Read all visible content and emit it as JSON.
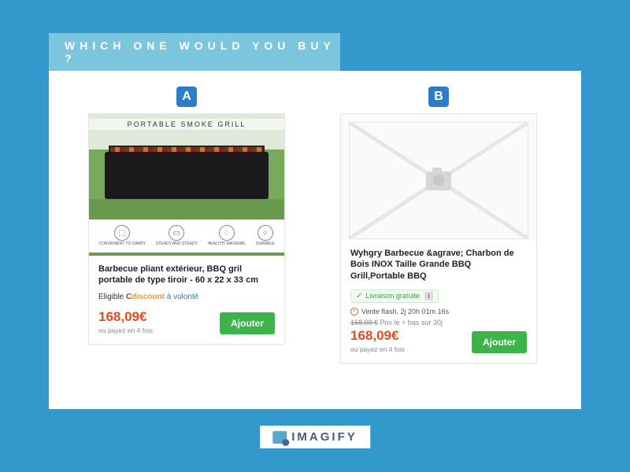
{
  "header": {
    "title": "WHICH ONE WOULD YOU BUY ?"
  },
  "badges": {
    "a": "A",
    "b": "B"
  },
  "cardA": {
    "image_overlay": "PORTABLE SMOKE GRILL",
    "features": {
      "f1": "CONVENIENT TO CARRY",
      "f2": "STEADY AND STEADY",
      "f3": "HEALTHY MATERIAL",
      "f4": "DURABLE"
    },
    "title": "Barbecue pliant extérieur, BBQ gril portable de type tiroir - 60 x 22 x 33 cm",
    "eligible_prefix": "Eligible ",
    "eligible_brand_c": "C",
    "eligible_brand_d": "discount",
    "eligible_vol": " à volonté",
    "price": "168,09€",
    "payplan": "ou payez en 4 fois",
    "add_label": "Ajouter"
  },
  "cardB": {
    "title": "Wyhgry Barbecue &agrave; Charbon de Bois INOX Taille Grande BBQ Grill,Portable BBQ",
    "ship_label": "Livraison gratuite",
    "ship_info": "i",
    "flash_label": "Vente flash, 2j 20h 01m 16s",
    "old_price_strike": "168,09 €",
    "old_price_note": " Prix le + bas sur 30j",
    "price": "168,09€",
    "payplan": "ou payez en 4 fois",
    "add_label": "Ajouter"
  },
  "footer": {
    "brand": "IMAGIFY"
  }
}
